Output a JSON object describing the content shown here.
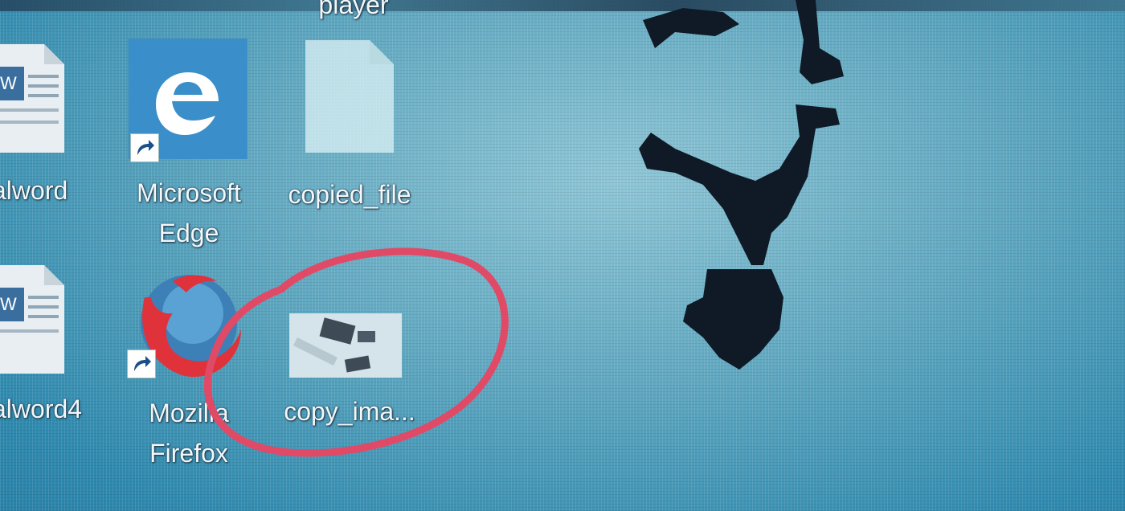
{
  "desktop": {
    "icons": [
      {
        "label": "player",
        "icon": "media-player-icon"
      },
      {
        "label": "alword",
        "icon": "word-document-icon"
      },
      {
        "label": "Microsoft Edge",
        "icon": "edge-icon"
      },
      {
        "label": "copied_file",
        "icon": "blank-file-icon"
      },
      {
        "label": "alword4",
        "icon": "word-document-icon"
      },
      {
        "label": "Mozilla Firefox",
        "icon": "firefox-icon"
      },
      {
        "label": "copy_ima...",
        "icon": "image-thumbnail-icon"
      }
    ],
    "annotation_color": "#e04a66",
    "accent_colors": {
      "edge_tile": "#3a8ec9",
      "firefox_red": "#e0323a"
    }
  }
}
